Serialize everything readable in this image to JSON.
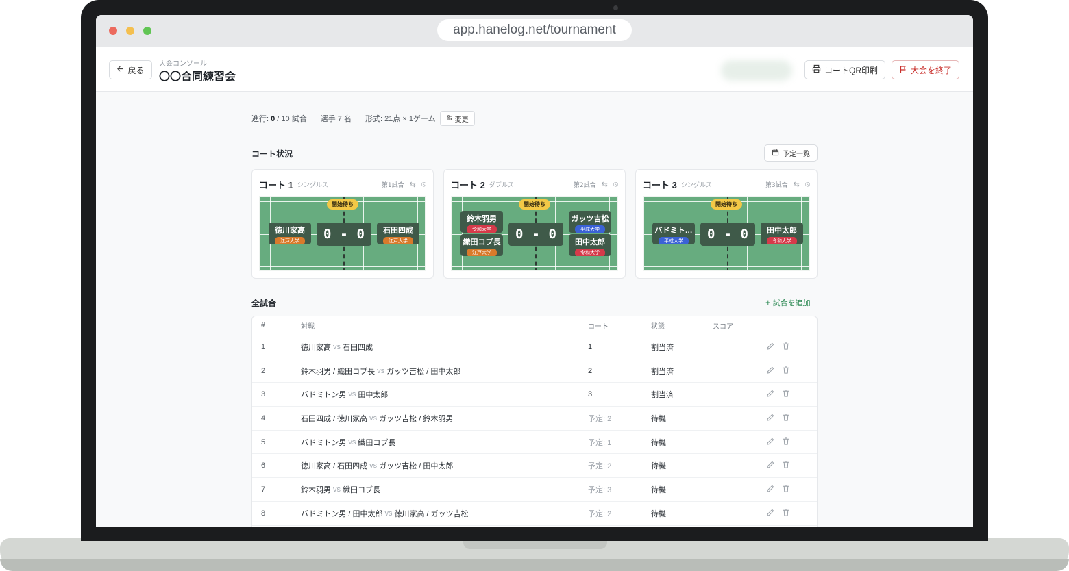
{
  "browser": {
    "url": "app.hanelog.net/tournament"
  },
  "header": {
    "back_label": "戻る",
    "breadcrumb": "大会コンソール",
    "title": "〇〇合同練習会",
    "qr_label": "コートQR印刷",
    "end_label": "大会を終了"
  },
  "stats": {
    "progress_prefix": "進行: ",
    "progress_done": "0",
    "progress_rest": " / 10 試合",
    "players": "選手 7 名",
    "format": "形式: 21点 × 1ゲーム",
    "change_label": "変更"
  },
  "courts_section": {
    "title": "コート状況",
    "schedule_label": "予定一覧"
  },
  "courts": [
    {
      "name": "コート 1",
      "type": "シングルス",
      "match": "第1試合",
      "status": "開始待ち",
      "score_left": "0",
      "score_right": "0",
      "dash": "-",
      "left": [
        {
          "name": "徳川家高",
          "team": "江戸大学",
          "color": "orange"
        }
      ],
      "right": [
        {
          "name": "石田四成",
          "team": "江戸大学",
          "color": "orange"
        }
      ]
    },
    {
      "name": "コート 2",
      "type": "ダブルス",
      "match": "第2試合",
      "status": "開始待ち",
      "score_left": "0",
      "score_right": "0",
      "dash": "-",
      "left": [
        {
          "name": "鈴木羽男",
          "team": "令和大学",
          "color": "red"
        },
        {
          "name": "織田コブ長",
          "team": "江戸大学",
          "color": "orange"
        }
      ],
      "right": [
        {
          "name": "ガッツ吉松",
          "team": "平成大学",
          "color": "blue"
        },
        {
          "name": "田中太郎",
          "team": "令和大学",
          "color": "red"
        }
      ]
    },
    {
      "name": "コート 3",
      "type": "シングルス",
      "match": "第3試合",
      "status": "開始待ち",
      "score_left": "0",
      "score_right": "0",
      "dash": "-",
      "left": [
        {
          "name": "バドミト…",
          "team": "平成大学",
          "color": "blue"
        }
      ],
      "right": [
        {
          "name": "田中太郎",
          "team": "令和大学",
          "color": "red"
        }
      ]
    }
  ],
  "matches_section": {
    "title": "全試合",
    "add_label": "試合を追加"
  },
  "table": {
    "headers": {
      "num": "#",
      "match": "対戦",
      "court": "コート",
      "state": "状態",
      "score": "スコア"
    },
    "vs": "vs",
    "rows": [
      {
        "num": "1",
        "left": "徳川家高",
        "right": "石田四成",
        "court": "1",
        "pending": false,
        "state": "割当済"
      },
      {
        "num": "2",
        "left": "鈴木羽男 / 織田コブ長",
        "right": "ガッツ吉松 / 田中太郎",
        "court": "2",
        "pending": false,
        "state": "割当済"
      },
      {
        "num": "3",
        "left": "バドミトン男",
        "right": "田中太郎",
        "court": "3",
        "pending": false,
        "state": "割当済"
      },
      {
        "num": "4",
        "left": "石田四成 / 徳川家高",
        "right": "ガッツ吉松 / 鈴木羽男",
        "court": "予定: 2",
        "pending": true,
        "state": "待機"
      },
      {
        "num": "5",
        "left": "バドミトン男",
        "right": "織田コブ長",
        "court": "予定: 1",
        "pending": true,
        "state": "待機"
      },
      {
        "num": "6",
        "left": "徳川家高 / 石田四成",
        "right": "ガッツ吉松 / 田中太郎",
        "court": "予定: 2",
        "pending": true,
        "state": "待機"
      },
      {
        "num": "7",
        "left": "鈴木羽男",
        "right": "織田コブ長",
        "court": "予定: 3",
        "pending": true,
        "state": "待機"
      },
      {
        "num": "8",
        "left": "バドミトン男 / 田中太郎",
        "right": "徳川家高 / ガッツ吉松",
        "court": "予定: 2",
        "pending": true,
        "state": "待機"
      }
    ]
  },
  "icons": {
    "back": "arrow-left-icon",
    "print": "printer-icon",
    "flag": "flag-icon",
    "sliders": "sliders-icon",
    "calendar": "calendar-icon",
    "swap": "swap-icon",
    "disable": "ban-icon",
    "plus": "plus-icon",
    "edit": "pencil-icon",
    "delete": "trash-icon"
  },
  "colors": {
    "accent_green": "#2e8a55",
    "court_green": "#67ac7f",
    "danger": "#c9302c",
    "waiting_badge": "#f3c846",
    "team_orange": "#d97a2b",
    "team_red": "#d63a4a",
    "team_blue": "#3b62d6"
  }
}
